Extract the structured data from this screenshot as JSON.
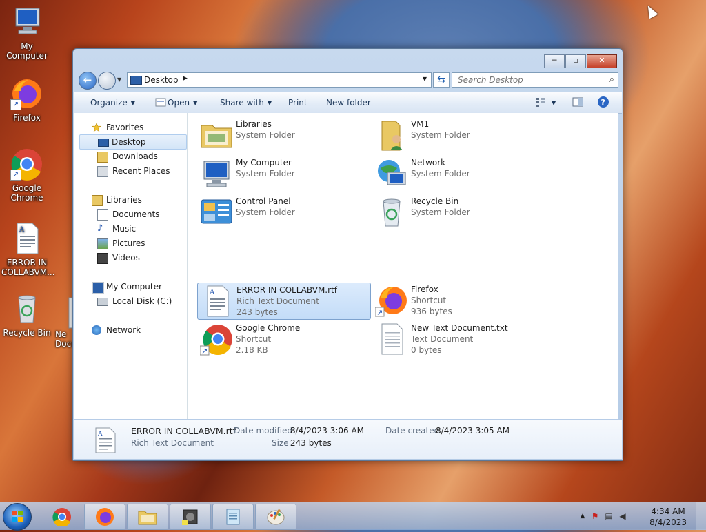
{
  "desktop": {
    "icons": [
      {
        "label": "My Computer"
      },
      {
        "label": "Firefox"
      },
      {
        "label": "Google Chrome"
      },
      {
        "label": "ERROR IN COLLABVM..."
      },
      {
        "label": "Recycle Bin"
      },
      {
        "label": "Ne Docu"
      }
    ]
  },
  "window": {
    "address": "Desktop",
    "search_placeholder": "Search Desktop",
    "toolbar": {
      "organize": "Organize",
      "open": "Open",
      "share_with": "Share with",
      "print": "Print",
      "new_folder": "New folder"
    },
    "nav": {
      "favorites": "Favorites",
      "desktop": "Desktop",
      "downloads": "Downloads",
      "recent_places": "Recent Places",
      "libraries": "Libraries",
      "documents": "Documents",
      "music": "Music",
      "pictures": "Pictures",
      "videos": "Videos",
      "my_computer": "My Computer",
      "local_disk": "Local Disk (C:)",
      "network": "Network"
    },
    "files": [
      {
        "name": "Libraries",
        "type": "System Folder",
        "size": ""
      },
      {
        "name": "VM1",
        "type": "System Folder",
        "size": ""
      },
      {
        "name": "My Computer",
        "type": "System Folder",
        "size": ""
      },
      {
        "name": "Network",
        "type": "System Folder",
        "size": ""
      },
      {
        "name": "Control Panel",
        "type": "System Folder",
        "size": ""
      },
      {
        "name": "Recycle Bin",
        "type": "System Folder",
        "size": ""
      },
      {
        "name": "ERROR IN COLLABVM.rtf",
        "type": "Rich Text Document",
        "size": "243 bytes"
      },
      {
        "name": "Firefox",
        "type": "Shortcut",
        "size": "936 bytes"
      },
      {
        "name": "Google Chrome",
        "type": "Shortcut",
        "size": "2.18 KB"
      },
      {
        "name": "New Text Document.txt",
        "type": "Text Document",
        "size": "0 bytes"
      }
    ],
    "details": {
      "name": "ERROR IN COLLABVM.rtf",
      "type": "Rich Text Document",
      "date_modified_label": "Date modified:",
      "date_modified": "8/4/2023 3:06 AM",
      "date_created_label": "Date created:",
      "date_created": "8/4/2023 3:05 AM",
      "size_label": "Size:",
      "size": "243 bytes"
    }
  },
  "taskbar": {
    "clock_time": "4:34 AM",
    "clock_date": "8/4/2023"
  },
  "colors": {
    "selection": "#cce0f8",
    "accent": "#1e395b"
  }
}
